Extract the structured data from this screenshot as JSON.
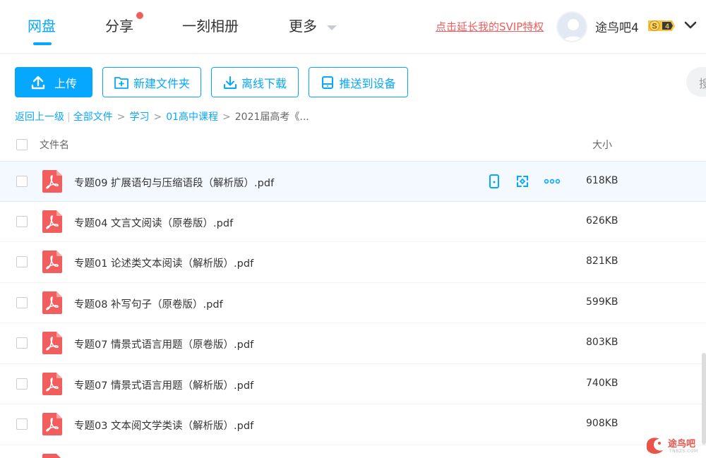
{
  "nav": {
    "tabs": [
      {
        "label": "网盘",
        "active": true
      },
      {
        "label": "分享",
        "active": false,
        "has_notification": true
      },
      {
        "label": "一刻相册",
        "active": false
      },
      {
        "label": "更多",
        "active": false,
        "has_dropdown": true
      }
    ],
    "svip_link": "点击延长我的SVIP特权",
    "username": "途鸟吧4",
    "vip_level": "4",
    "vip_letter": "S"
  },
  "toolbar": {
    "upload": "上传",
    "new_folder": "新建文件夹",
    "offline_download": "离线下载",
    "push_to_device": "推送到设备",
    "search_stub": "搜"
  },
  "breadcrumb": {
    "back": "返回上一级",
    "items": [
      "全部文件",
      "学习",
      "01高中课程"
    ],
    "current": "2021届高考《..."
  },
  "list": {
    "col_name": "文件名",
    "col_size": "大小",
    "files": [
      {
        "name": "专题09 扩展语句与压缩语段（解析版）.pdf",
        "size": "618KB",
        "hover": true
      },
      {
        "name": "专题04 文言文阅读（原卷版）.pdf",
        "size": "626KB"
      },
      {
        "name": "专题01 论述类文本阅读（解析版）.pdf",
        "size": "821KB"
      },
      {
        "name": "专题08 补写句子（原卷版）.pdf",
        "size": "599KB"
      },
      {
        "name": "专题07 情景式语言用题（原卷版）.pdf",
        "size": "803KB"
      },
      {
        "name": "专题07 情景式语言用题（解析版）.pdf",
        "size": "740KB"
      },
      {
        "name": "专题03 文本阅文学类读（解析版）.pdf",
        "size": "908KB"
      }
    ]
  },
  "watermark": {
    "text": "途鸟吧",
    "sub": "TNBZS.COM"
  },
  "colors": {
    "accent": "#06a7ff",
    "alert": "#f25d5d",
    "pdf": "#f25d5d"
  }
}
